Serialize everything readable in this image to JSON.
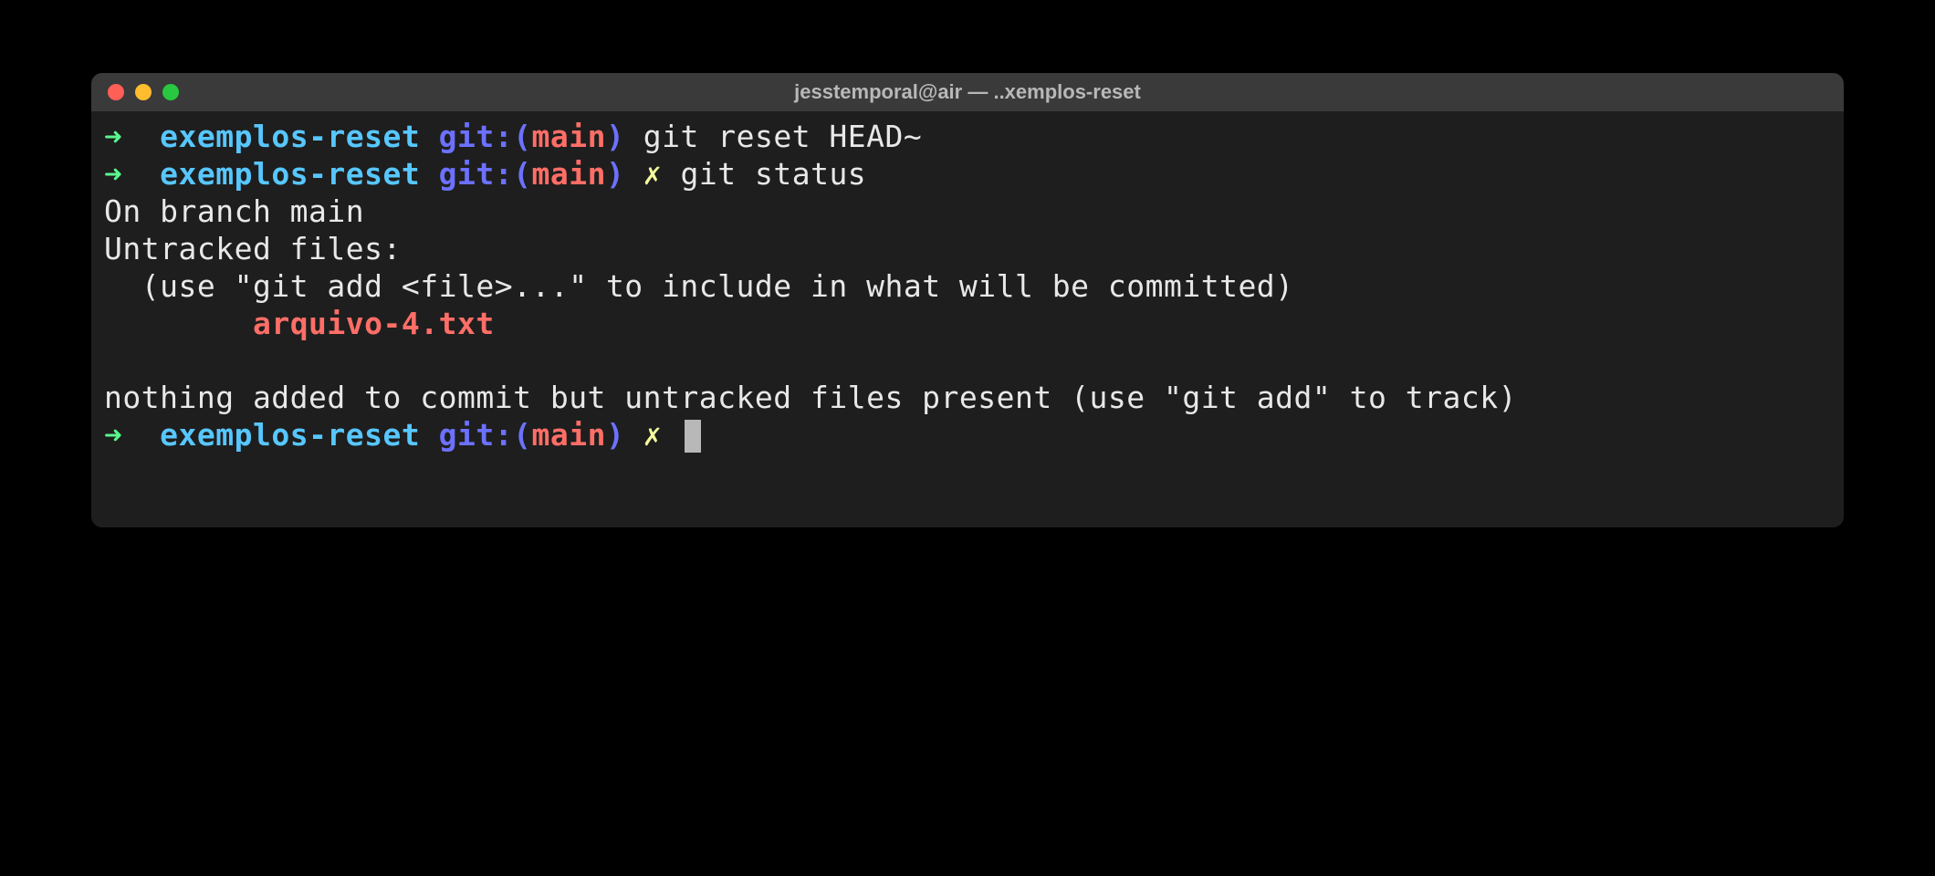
{
  "window": {
    "title": "jesstemporal@air — ..xemplos-reset"
  },
  "prompt": {
    "arrow": "➜",
    "directory": "exemplos-reset",
    "git_label": "git:",
    "paren_open": "(",
    "branch": "main",
    "paren_close": ")",
    "dirty_marker": "✗"
  },
  "lines": {
    "cmd1": "git reset HEAD~",
    "cmd2": "git status",
    "out1": "On branch main",
    "out2": "Untracked files:",
    "out3": "  (use \"git add <file>...\" to include in what will be committed)",
    "out4_indent": "\t",
    "out4_file": "arquivo-4.txt",
    "out5": "nothing added to commit but untracked files present (use \"git add\" to track)"
  }
}
